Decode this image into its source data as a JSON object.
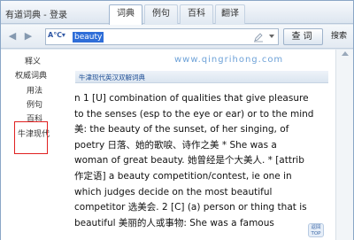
{
  "window": {
    "title": "有道词典 - 登录"
  },
  "tabs": [
    "词典",
    "例句",
    "百科",
    "翻译"
  ],
  "active_tab": 0,
  "search": {
    "lang": "A℃▾",
    "query": "beauty",
    "lookup_label": "查词",
    "search_label": "搜索"
  },
  "sidebar": {
    "items": [
      "释义",
      "权威词典",
      "用法",
      "例句",
      "百科",
      "牛津现代"
    ],
    "selected": "牛津现代"
  },
  "source": {
    "name": "牛津现代英汉双解词典"
  },
  "watermark": "www.qingrihong.com",
  "entry_lines": [
    "n 1 [U] combination of qualities that give pleasure",
    "to the senses (esp to the eye or ear) or to the mind",
    "美: the beauty of the sunset, of her singing, of",
    "poetry 日落、她的歌唳、诗作之美 * She was a",
    "woman of great beauty. 她曾经是个大美人. * [attrib",
    "作定语] a beauty competition/contest, ie one in",
    "which judges decide on the most beautiful",
    "competitor 选美会. 2 [C] (a) person or thing that is",
    "beautiful 美丽的人或事物: She was a famous"
  ],
  "top_button": {
    "line1": "返回",
    "line2": "TOP"
  },
  "colors": {
    "selection_border": "#e02020",
    "highlight": "#2f6ed8",
    "link": "#1f4f96"
  }
}
